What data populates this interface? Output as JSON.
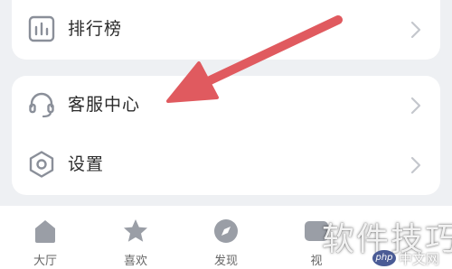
{
  "menu": {
    "top_items": [
      {
        "label": "排行榜",
        "icon": "bar-chart-icon"
      }
    ],
    "items": [
      {
        "label": "客服中心",
        "icon": "headset-icon"
      },
      {
        "label": "设置",
        "icon": "settings-hexagon-icon"
      }
    ]
  },
  "tabbar": {
    "tabs": [
      {
        "label": "大厅",
        "icon": "home-icon"
      },
      {
        "label": "喜欢",
        "icon": "star-icon"
      },
      {
        "label": "发现",
        "icon": "compass-icon"
      },
      {
        "label": "视",
        "icon": "video-icon"
      }
    ]
  },
  "watermark": {
    "text": "软件技巧",
    "logo_badge": "php",
    "logo_text": "中文网"
  },
  "colors": {
    "background": "#eef0f3",
    "card": "#ffffff",
    "annotation_arrow": "#e05a5f",
    "icon_gray": "#8a8f99"
  }
}
